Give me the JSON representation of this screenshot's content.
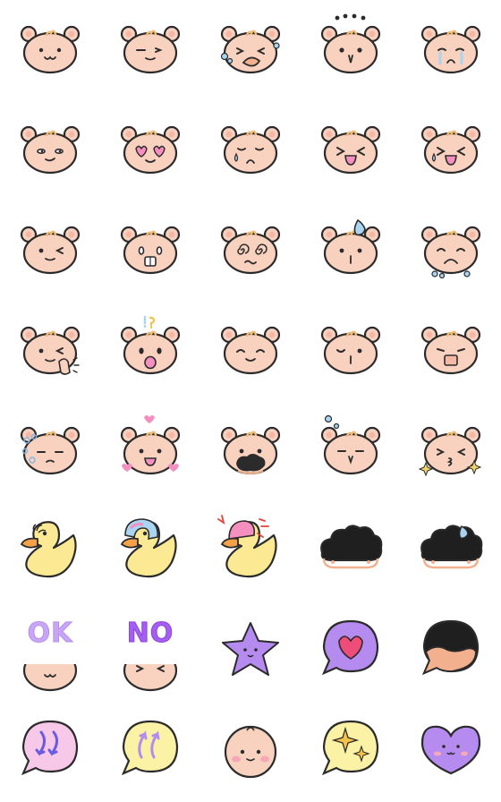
{
  "sheet": {
    "background": "#ffffff",
    "palette": {
      "bear_skin": "#f8d2bf",
      "bear_tuft": "#f1b873",
      "outline": "#2b2b2b",
      "duck_yellow": "#fbe993",
      "duck_beak": "#f3a24a",
      "tear_blue": "#a9d4f2",
      "heart_pink": "#f48fc0",
      "purple": "#b58bf0",
      "bubble_pink": "#f7c8e8",
      "bubble_yellow": "#fbf2a6",
      "blush": "#f7a8b8"
    },
    "rows": [
      [
        "bear-smile-icon",
        "bear-wink-icon",
        "bear-crying-blowing-icon",
        "bear-shocked-dots-icon",
        "bear-tearful-icon"
      ],
      [
        "bear-smug-icon",
        "bear-heart-eyes-icon",
        "bear-worried-sweat-icon",
        "bear-squint-laugh-icon",
        "bear-teardrop-laugh-icon"
      ],
      [
        "bear-wink-tongue-icon",
        "bear-teeth-icon",
        "bear-dizzy-icon",
        "bear-sweat-drop-icon",
        "bear-sobbing-icon"
      ],
      [
        "bear-wink-wave-icon",
        "bear-surprised-icon",
        "bear-content-icon",
        "bear-unimpressed-icon",
        "bear-mask-icon"
      ],
      [
        "bear-sad-bubbles-icon",
        "bear-love-hearts-icon",
        "bear-black-blob-icon",
        "bear-bubbles-icon",
        "bear-kiss-sparkle-icon"
      ],
      [
        "duck-icon",
        "duck-pacifier-icon",
        "duck-angry-icon",
        "black-cloud-icon",
        "black-cloud-sweat-icon"
      ],
      [
        "bear-ok-sign-icon",
        "bear-no-sign-icon",
        "purple-star-icon",
        "heart-speech-bubble-icon",
        "black-speech-bubble-icon"
      ],
      [
        "down-arrows-bubble-icon",
        "up-arrows-bubble-icon",
        "baby-face-icon",
        "sparkle-bubble-icon",
        "purple-heart-face-icon"
      ]
    ],
    "labels": {
      "ok": "OK",
      "no": "NO"
    }
  }
}
